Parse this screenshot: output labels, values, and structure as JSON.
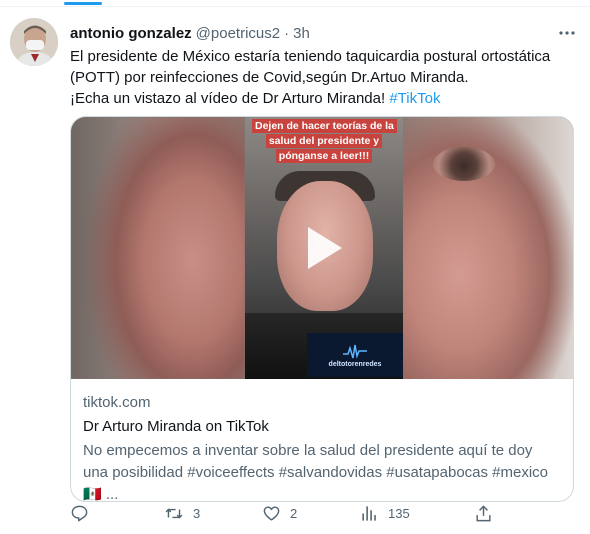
{
  "tweet": {
    "author_name": "antonio gonzalez",
    "handle": "@poetricus2",
    "separator": "·",
    "time": "3h",
    "text_line1": "El presidente de México estaría teniendo taquicardia postural ortostática (POTT) por reinfecciones de Covid,según Dr.Artuo Miranda.",
    "text_line2": "¡Echa un vistazo al vídeo de Dr Arturo Miranda!",
    "hashtag": "#TikTok"
  },
  "card": {
    "caption": "Dejen de hacer teorías de la salud del presidente y pónganse a leer!!!",
    "logo_text": "deltotorenredes",
    "domain": "tiktok.com",
    "title": "Dr Arturo Miranda on TikTok",
    "description": "No empecemos a inventar sobre la salud del presidente aquí te doy una posibilidad #voiceeffects #salvandovidas #usatapabocas #mexico🇲🇽 ..."
  },
  "actions": {
    "reply_count": "",
    "retweet_count": "3",
    "like_count": "2",
    "views_count": "135"
  },
  "icons": [
    "more-icon",
    "play-icon",
    "reply-icon",
    "retweet-icon",
    "like-icon",
    "analytics-icon",
    "share-icon"
  ],
  "colors": {
    "accent": "#1d9bf0",
    "text_primary": "#0f1419",
    "text_secondary": "#536471",
    "border": "#cfd9de",
    "caption_bg": "#c8433d"
  }
}
